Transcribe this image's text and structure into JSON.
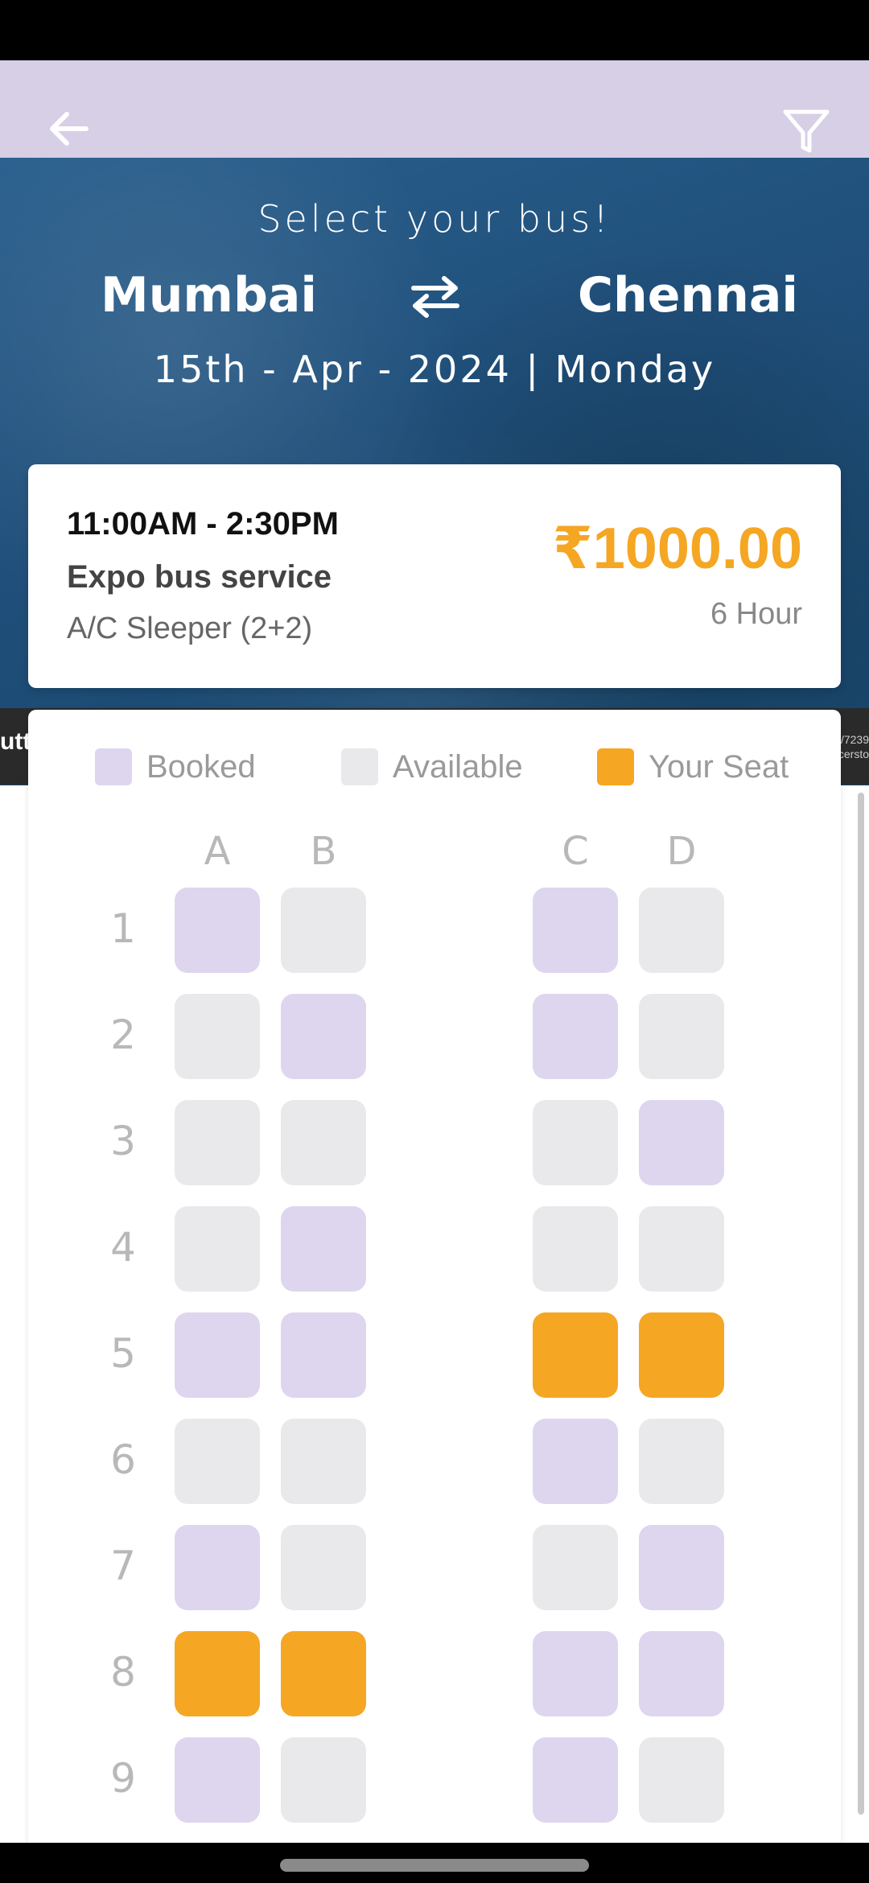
{
  "header": {
    "back_icon": "arrow-left-icon",
    "filter_icon": "filter-icon",
    "bar_color": "#d6cfe6"
  },
  "hero": {
    "title": "Select your bus!",
    "from_city": "Mumbai",
    "to_city": "Chennai",
    "swap_icon": "swap-arrows-icon",
    "date": "15th - Apr - 2024 | Monday"
  },
  "bus_card": {
    "time": "11:00AM - 2:30PM",
    "name": "Expo bus service",
    "type": "A/C Sleeper (2+2)",
    "price": "₹1000.00",
    "duration": "6 Hour",
    "price_color": "#f5a623"
  },
  "background_strip": {
    "left_text": "utt",
    "right_text_line1": "/7239",
    "right_text_line2": "cersto"
  },
  "legend": {
    "booked_label": "Booked",
    "available_label": "Available",
    "your_seat_label": "Your Seat",
    "booked_color": "#ddd6ee",
    "available_color": "#e9e9ec",
    "your_seat_color": "#f5a623"
  },
  "seat_map": {
    "columns": [
      "A",
      "B",
      "C",
      "D"
    ],
    "rows": [
      {
        "label": "1",
        "seats": [
          "booked",
          "available",
          "booked",
          "available"
        ]
      },
      {
        "label": "2",
        "seats": [
          "available",
          "booked",
          "booked",
          "available"
        ]
      },
      {
        "label": "3",
        "seats": [
          "available",
          "available",
          "available",
          "booked"
        ]
      },
      {
        "label": "4",
        "seats": [
          "available",
          "booked",
          "available",
          "available"
        ]
      },
      {
        "label": "5",
        "seats": [
          "booked",
          "booked",
          "yours",
          "yours"
        ]
      },
      {
        "label": "6",
        "seats": [
          "available",
          "available",
          "booked",
          "available"
        ]
      },
      {
        "label": "7",
        "seats": [
          "booked",
          "available",
          "available",
          "booked"
        ]
      },
      {
        "label": "8",
        "seats": [
          "yours",
          "yours",
          "booked",
          "booked"
        ]
      },
      {
        "label": "9",
        "seats": [
          "booked",
          "available",
          "booked",
          "available"
        ]
      }
    ]
  }
}
